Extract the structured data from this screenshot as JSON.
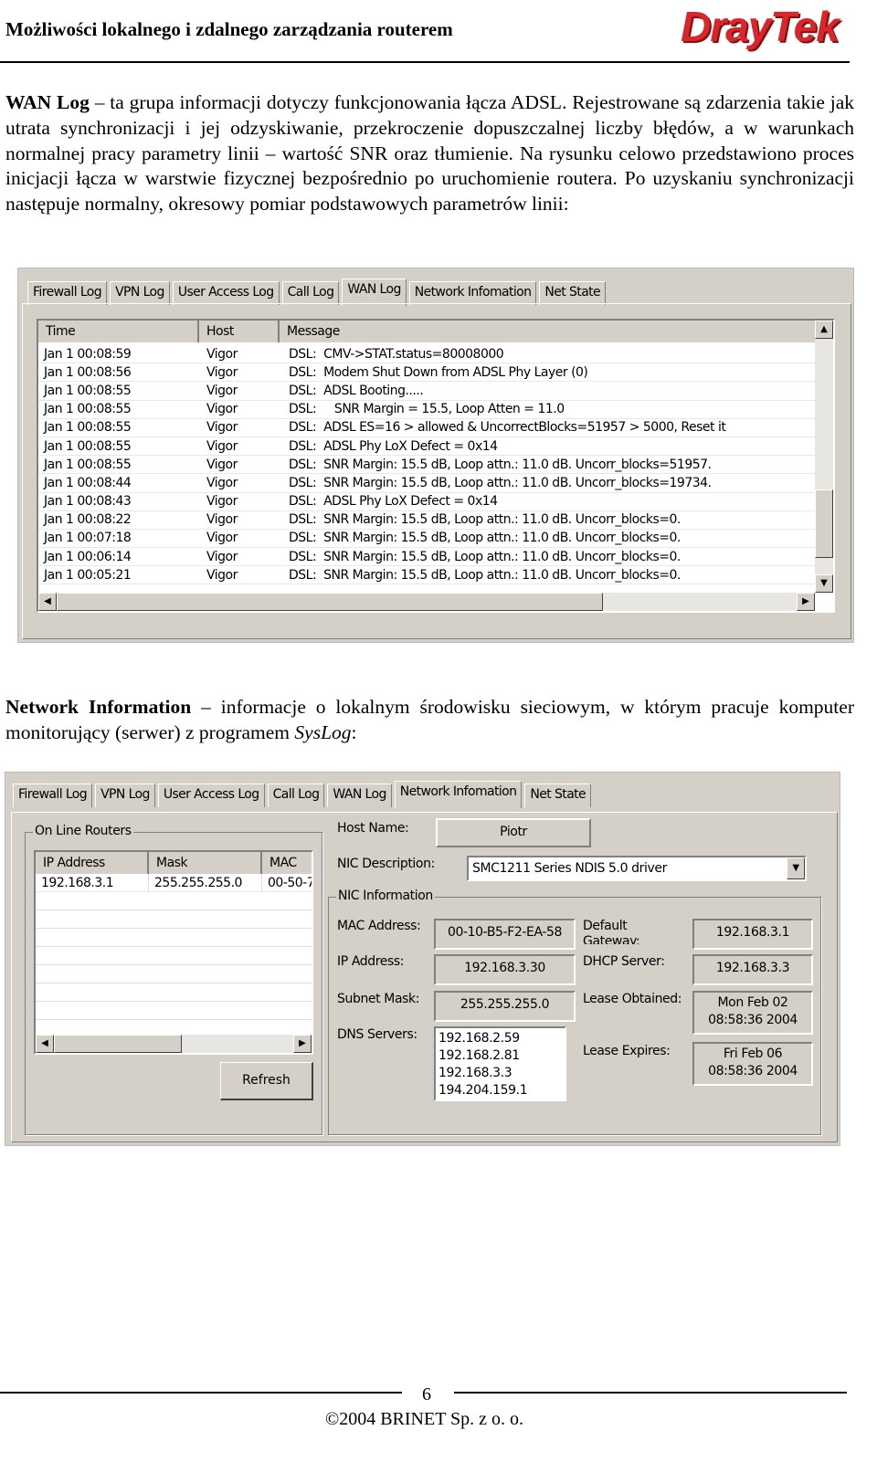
{
  "header": {
    "title": "Możliwości lokalnego i zdalnego zarządzania routerem",
    "logo": "DrayTek"
  },
  "para1": {
    "bold": "WAN Log",
    "text": " – ta grupa informacji dotyczy funkcjonowania łącza ADSL. Rejestrowane są zdarzenia takie jak utrata synchronizacji i jej odzyskiwanie, przekroczenie dopuszczalnej liczby błędów, a w warunkach normalnej pracy parametry linii – wartość SNR oraz tłumienie. Na rysunku celowo przedstawiono proces inicjacji łącza w warstwie fizycznej bezpośrednio po uruchomienie routera. Po uzyskaniu synchronizacji następuje normalny, okresowy pomiar podstawowych parametrów linii:"
  },
  "tabs": [
    "Firewall Log",
    "VPN Log",
    "User Access Log",
    "Call Log",
    "WAN Log",
    "Network Infomation",
    "Net State"
  ],
  "wan": {
    "columns": [
      "Time",
      "Host",
      "Message"
    ],
    "rows": [
      [
        "Jan 1 00:08:59",
        "Vigor",
        "DSL:  CMV->STAT.status=80008000"
      ],
      [
        "Jan 1 00:08:56",
        "Vigor",
        "DSL:  Modem Shut Down from ADSL Phy Layer (0)"
      ],
      [
        "Jan 1 00:08:55",
        "Vigor",
        "DSL:  ADSL Booting....."
      ],
      [
        "Jan 1 00:08:55",
        "Vigor",
        "DSL:     SNR Margin = 15.5, Loop Atten = 11.0"
      ],
      [
        "Jan 1 00:08:55",
        "Vigor",
        "DSL:  ADSL ES=16 > allowed & UncorrectBlocks=51957 > 5000, Reset it"
      ],
      [
        "Jan 1 00:08:55",
        "Vigor",
        "DSL:  ADSL Phy LoX Defect = 0x14"
      ],
      [
        "Jan 1 00:08:55",
        "Vigor",
        "DSL:  SNR Margin: 15.5 dB, Loop attn.: 11.0 dB. Uncorr_blocks=51957."
      ],
      [
        "Jan 1 00:08:44",
        "Vigor",
        "DSL:  SNR Margin: 15.5 dB, Loop attn.: 11.0 dB. Uncorr_blocks=19734."
      ],
      [
        "Jan 1 00:08:43",
        "Vigor",
        "DSL:  ADSL Phy LoX Defect = 0x14"
      ],
      [
        "Jan 1 00:08:22",
        "Vigor",
        "DSL:  SNR Margin: 15.5 dB, Loop attn.: 11.0 dB. Uncorr_blocks=0."
      ],
      [
        "Jan 1 00:07:18",
        "Vigor",
        "DSL:  SNR Margin: 15.5 dB, Loop attn.: 11.0 dB. Uncorr_blocks=0."
      ],
      [
        "Jan 1 00:06:14",
        "Vigor",
        "DSL:  SNR Margin: 15.5 dB, Loop attn.: 11.0 dB. Uncorr_blocks=0."
      ],
      [
        "Jan 1 00:05:21",
        "Vigor",
        "DSL:  SNR Margin: 15.5 dB, Loop attn.: 11.0 dB. Uncorr_blocks=0."
      ]
    ]
  },
  "para2": {
    "bold": "Network Information",
    "text": " – informacje o lokalnym środowisku sieciowym, w którym pracuje komputer monitorujący (serwer) z programem ",
    "italic": "SysLog",
    "end": ":"
  },
  "net": {
    "online_routers": "On Line Routers",
    "columns": [
      "IP Address",
      "Mask",
      "MAC"
    ],
    "row": [
      "192.168.3.1",
      "255.255.255.0",
      "00-50-7"
    ],
    "refresh": "Refresh",
    "host_name_label": "Host Name:",
    "host_name": "Piotr",
    "nic_desc_label": "NIC Description:",
    "nic_desc": "SMC1211 Series NDIS 5.0 driver",
    "nic_info": "NIC Information",
    "mac_label": "MAC Address:",
    "mac": "00-10-B5-F2-EA-58",
    "ip_label": "IP Address:",
    "ip": "192.168.3.30",
    "mask_label": "Subnet Mask:",
    "mask": "255.255.255.0",
    "dns_label": "DNS Servers:",
    "dns": [
      "192.168.2.59",
      "192.168.2.81",
      "192.168.3.3",
      "194.204.159.1"
    ],
    "gw_label": "Default Gateway:",
    "gw": "192.168.3.1",
    "dhcp_label": "DHCP Server:",
    "dhcp": "192.168.3.3",
    "lo_label": "Lease Obtained:",
    "lo1": "Mon Feb 02",
    "lo2": "08:58:36 2004",
    "le_label": "Lease Expires:",
    "le1": "Fri Feb 06",
    "le2": "08:58:36 2004"
  },
  "footer": {
    "page": "6",
    "copyright": "©2004 BRINET Sp. z  o. o."
  }
}
